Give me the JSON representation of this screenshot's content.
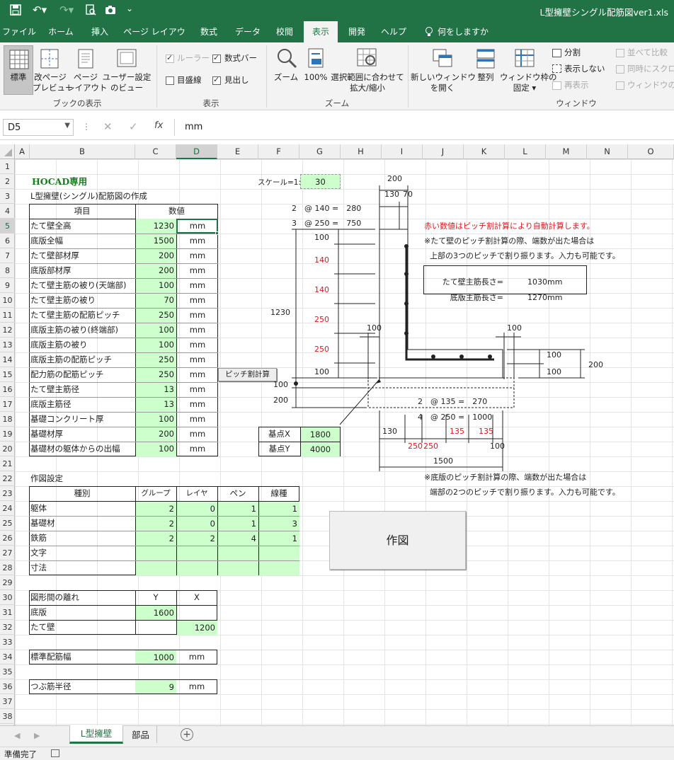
{
  "titlebar": {
    "title": "L型擁壁シングル配筋図ver1.xls",
    "qat_more": "⌄"
  },
  "tabs": [
    {
      "label": "ファイル"
    },
    {
      "label": "ホーム"
    },
    {
      "label": "挿入"
    },
    {
      "label": "ページ レイアウト"
    },
    {
      "label": "数式"
    },
    {
      "label": "データ"
    },
    {
      "label": "校閲"
    },
    {
      "label": "表示"
    },
    {
      "label": "開発"
    },
    {
      "label": "ヘルプ"
    },
    {
      "label": "何をしますか"
    }
  ],
  "ribbon": {
    "views": {
      "normal": "標準",
      "pagebreak1": "改ページ",
      "pagebreak2": "プレビュー",
      "pagelayout1": "ページ",
      "pagelayout2": "レイアウト",
      "custom1": "ユーザー設定",
      "custom2": "のビュー",
      "group": "ブックの表示"
    },
    "show": {
      "ruler": "ルーラー",
      "formulabar": "数式バー",
      "gridlines": "目盛線",
      "headings": "見出し",
      "group": "表示"
    },
    "zoom": {
      "zoom": "ズーム",
      "z100": "100%",
      "zoomsel1": "選択範囲に合わせて",
      "zoomsel2": "拡大/縮小",
      "group": "ズーム"
    },
    "window": {
      "newwin1": "新しいウィンドウ",
      "newwin2": "を開く",
      "arrange": "整列",
      "freeze1": "ウィンドウ枠の",
      "freeze2": "固定",
      "split": "分割",
      "hide": "表示しない",
      "unhide": "再表示",
      "side": "並べて比較",
      "sync": "同時にスクロール",
      "reset": "ウィンドウの位置",
      "group": "ウィンドウ"
    }
  },
  "formula": {
    "namebox": "D5",
    "value": "mm",
    "fx": "fx"
  },
  "columns": [
    "A",
    "B",
    "C",
    "D",
    "E",
    "F",
    "G",
    "H",
    "I",
    "J",
    "K",
    "L",
    "M",
    "N",
    "O"
  ],
  "rows": [
    "1",
    "2",
    "3",
    "4",
    "5",
    "6",
    "7",
    "8",
    "9",
    "10",
    "11",
    "12",
    "13",
    "14",
    "15",
    "16",
    "17",
    "18",
    "19",
    "20",
    "21",
    "22",
    "23",
    "24",
    "25",
    "26",
    "27",
    "28",
    "29",
    "30",
    "31",
    "32",
    "33",
    "34",
    "35",
    "36",
    "37",
    "38"
  ],
  "sheet": {
    "title": "HOCAD専用",
    "subtitle": "L型擁壁(シングル)配筋図の作成",
    "param_header": {
      "item": "項目",
      "value": "数値"
    },
    "params": [
      {
        "label": "たて壁全高",
        "value": "1230",
        "unit": "mm"
      },
      {
        "label": "底版全幅",
        "value": "1500",
        "unit": "mm"
      },
      {
        "label": "たて壁部材厚",
        "value": "200",
        "unit": "mm"
      },
      {
        "label": "底版部材厚",
        "value": "200",
        "unit": "mm"
      },
      {
        "label": "たて壁主筋の被り(天端部)",
        "value": "100",
        "unit": "mm"
      },
      {
        "label": "たて壁主筋の被り",
        "value": "70",
        "unit": "mm"
      },
      {
        "label": "たて壁主筋の配筋ピッチ",
        "value": "250",
        "unit": "mm"
      },
      {
        "label": "底版主筋の被り(終端部)",
        "value": "100",
        "unit": "mm"
      },
      {
        "label": "底版主筋の被り",
        "value": "100",
        "unit": "mm"
      },
      {
        "label": "底版主筋の配筋ピッチ",
        "value": "250",
        "unit": "mm"
      },
      {
        "label": "配力筋の配筋ピッチ",
        "value": "250",
        "unit": "mm"
      },
      {
        "label": "たて壁主筋径",
        "value": "13",
        "unit": "mm"
      },
      {
        "label": "底版主筋径",
        "value": "13",
        "unit": "mm"
      },
      {
        "label": "基礎コンクリート厚",
        "value": "100",
        "unit": "mm"
      },
      {
        "label": "基礎材厚",
        "value": "200",
        "unit": "mm"
      },
      {
        "label": "基礎材の躯体からの出幅",
        "value": "100",
        "unit": "mm"
      }
    ],
    "pitch_button": "ピッチ割計算",
    "scale_label": "スケール=1:",
    "scale_value": "30",
    "draw_settings": "作図設定",
    "draw_header": [
      "種別",
      "グループ",
      "レイヤ",
      "ペン",
      "線種"
    ],
    "draw_rows": [
      {
        "kind": "躯体",
        "vals": [
          "2",
          "0",
          "1",
          "1"
        ]
      },
      {
        "kind": "基礎材",
        "vals": [
          "2",
          "0",
          "1",
          "3"
        ]
      },
      {
        "kind": "鉄筋",
        "vals": [
          "2",
          "2",
          "4",
          "1"
        ]
      },
      {
        "kind": "文字",
        "vals": [
          "",
          "",
          "",
          ""
        ]
      },
      {
        "kind": "寸法",
        "vals": [
          "",
          "",
          "",
          ""
        ]
      }
    ],
    "spacing": {
      "label": "図形間の離れ",
      "y": "Y",
      "x": "X",
      "bottom": "底版",
      "bottom_y": "1600",
      "wall": "たて壁",
      "wall_x": "1200"
    },
    "std_width": {
      "label": "標準配筋幅",
      "value": "1000",
      "unit": "mm"
    },
    "hook": {
      "label": "つぶ筋半径",
      "value": "9",
      "unit": "mm"
    },
    "basex": {
      "label": "基点X",
      "value": "1800"
    },
    "basey": {
      "label": "基点Y",
      "value": "4000"
    },
    "draw_button": "作図",
    "notes": {
      "red": "赤い数値はピッチ割計算により自動計算します。",
      "n1": "※たて壁のピッチ割計算の際、端数が出た場合は",
      "n2": "上部の3つのピッチで割り振ります。入力も可能です。",
      "len_wall_label": "たて壁主筋長さ=",
      "len_wall": "1030",
      "len_base_label": "底版主筋長さ=",
      "len_base": "1270",
      "len_unit": "mm",
      "b1": "※底版のピッチ割計算の際、端数が出た場合は",
      "b2": "端部の2つのピッチで割り振ります。入力も可能です。"
    },
    "dims": {
      "top": "200",
      "top_a": "130",
      "top_b": "70",
      "pitch1": "2　@ 140 =　280",
      "pitch2": "3　@ 250 =　750",
      "v100a": "100",
      "v140a": "140",
      "v140b": "140",
      "v250a": "250",
      "v250b": "250",
      "v100b": "100",
      "h1230": "1230",
      "found100": "100",
      "base200": "200",
      "left100": "100",
      "right100": "100",
      "r100a": "100",
      "r100b": "100",
      "r200": "200",
      "bp1": "2　@ 135 =　270",
      "bp2": "4　@ 250 =　1000",
      "b130": "130",
      "b250a": "250",
      "b250b": "250",
      "b135a": "135",
      "b135b": "135",
      "b100": "100",
      "b1500": "1500"
    }
  },
  "sheettabs": {
    "active": "L型擁壁",
    "other": "部品",
    "add": "+"
  },
  "status": {
    "ready": "準備完了"
  }
}
